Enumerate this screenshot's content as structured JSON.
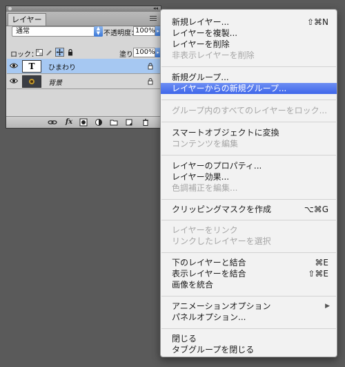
{
  "panel": {
    "tab_label": "レイヤー",
    "blend_mode": "通常",
    "opacity_label": "不透明度：",
    "opacity_value": "100%",
    "lock_label": "ロック：",
    "fill_label": "塗り：",
    "fill_value": "100%",
    "layers": [
      {
        "name": "ひまわり",
        "thumb": "T",
        "type": "text",
        "selected": true
      },
      {
        "name": "背景",
        "type": "image",
        "selected": false
      }
    ],
    "bottom_icons": [
      "link-icon",
      "fx-icon",
      "mask-icon",
      "adjustment-icon",
      "group-folder-icon",
      "new-layer-icon",
      "trash-icon"
    ],
    "fx_label": "fx"
  },
  "menu": {
    "items": [
      {
        "label": "新規レイヤー...",
        "shortcut": "⇧⌘N",
        "enabled": true
      },
      {
        "label": "レイヤーを複製...",
        "enabled": true
      },
      {
        "label": "レイヤーを削除",
        "enabled": true
      },
      {
        "label": "非表示レイヤーを削除",
        "enabled": false
      },
      {
        "label": "新規グループ...",
        "enabled": true
      },
      {
        "label": "レイヤーからの新規グループ...",
        "enabled": true,
        "highlighted": true
      },
      {
        "label": "グループ内のすべてのレイヤーをロック...",
        "enabled": false
      },
      {
        "label": "スマートオブジェクトに変換",
        "enabled": true
      },
      {
        "label": "コンテンツを編集",
        "enabled": false
      },
      {
        "label": "レイヤーのプロパティ...",
        "enabled": true
      },
      {
        "label": "レイヤー効果...",
        "enabled": true
      },
      {
        "label": "色調補正を編集...",
        "enabled": false
      },
      {
        "label": "クリッピングマスクを作成",
        "shortcut": "⌥⌘G",
        "enabled": true
      },
      {
        "label": "レイヤーをリンク",
        "enabled": false
      },
      {
        "label": "リンクしたレイヤーを選択",
        "enabled": false
      },
      {
        "label": "下のレイヤーと結合",
        "shortcut": "⌘E",
        "enabled": true
      },
      {
        "label": "表示レイヤーを結合",
        "shortcut": "⇧⌘E",
        "enabled": true
      },
      {
        "label": "画像を統合",
        "enabled": true
      },
      {
        "label": "アニメーションオプション",
        "enabled": true,
        "submenu": true
      },
      {
        "label": "パネルオプション...",
        "enabled": true
      },
      {
        "label": "閉じる",
        "enabled": true
      },
      {
        "label": "タブグループを閉じる",
        "enabled": true
      }
    ],
    "submenu_arrow": "▶"
  }
}
